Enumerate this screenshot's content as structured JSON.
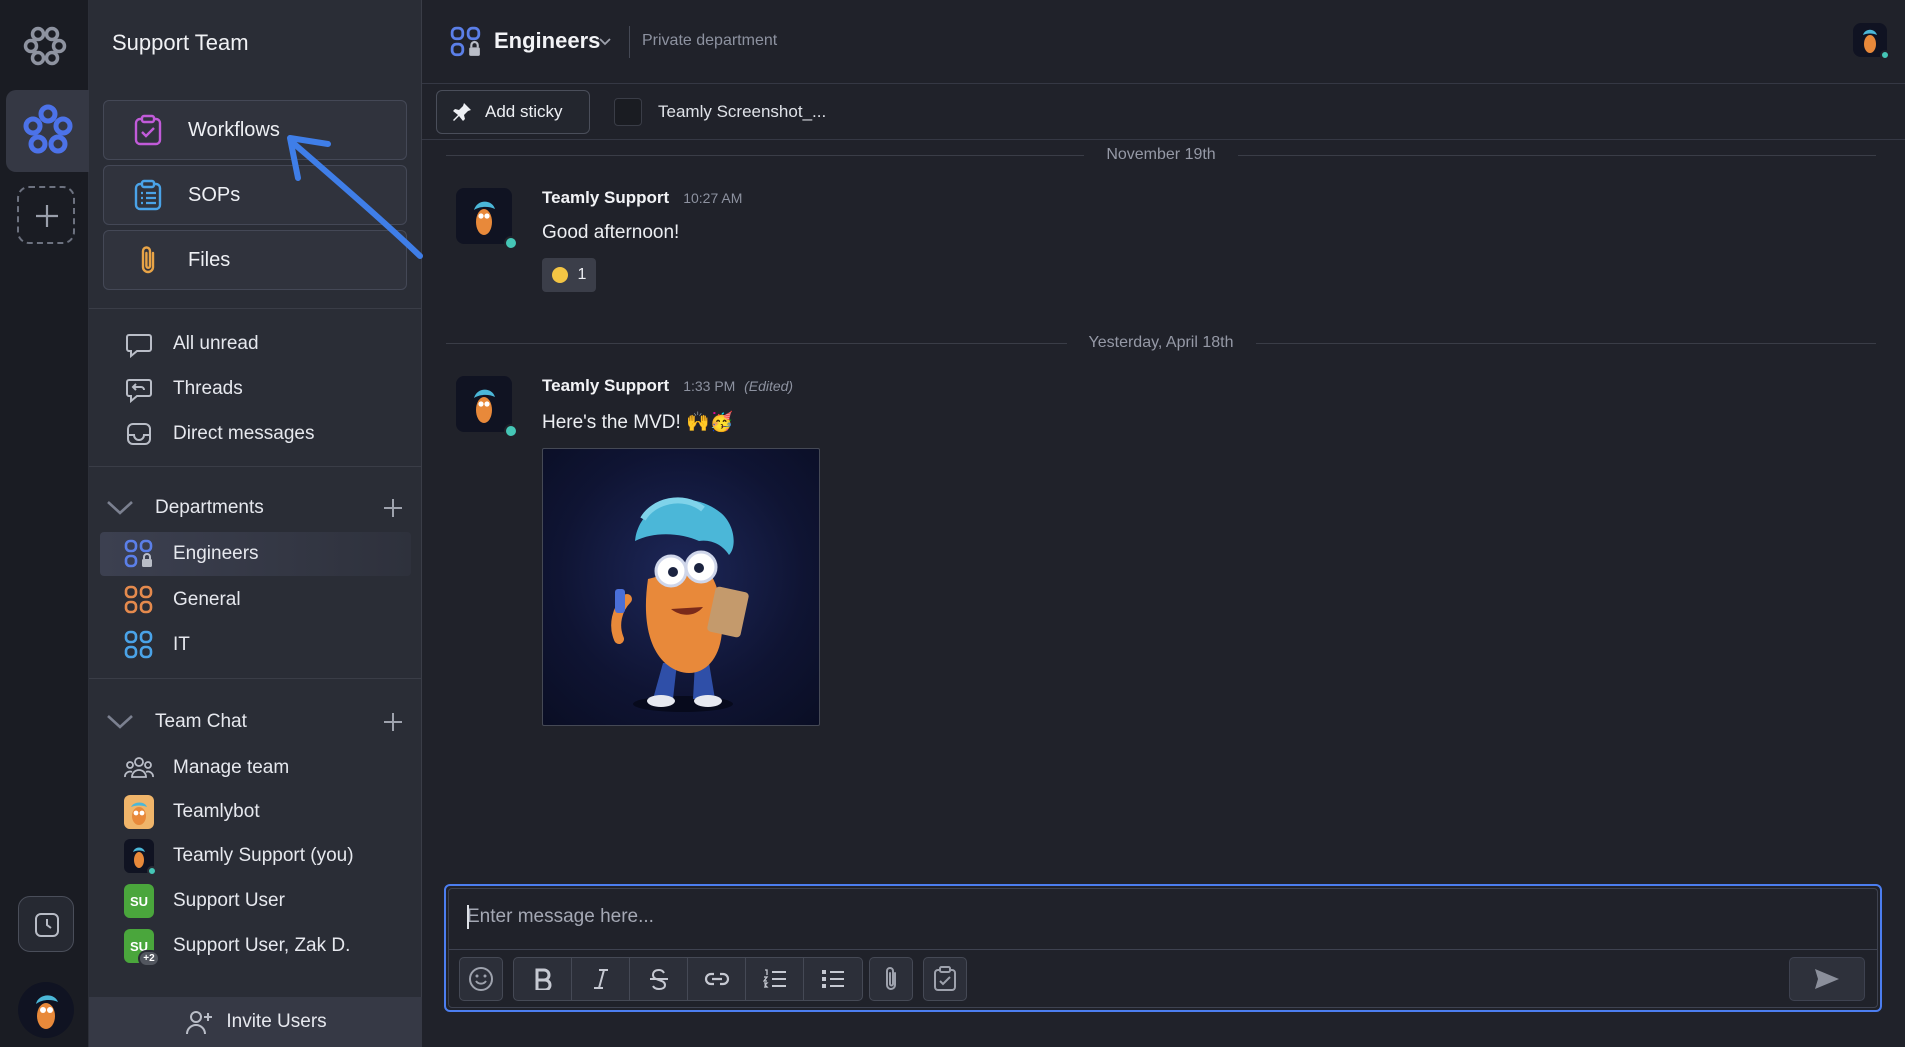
{
  "workspace": {
    "name": "Support Team"
  },
  "tools": [
    {
      "id": "workflows",
      "label": "Workflows",
      "icon": "clipboard-check-icon",
      "color": "#c15bd9"
    },
    {
      "id": "sops",
      "label": "SOPs",
      "icon": "clipboard-list-icon",
      "color": "#4aa3e8"
    },
    {
      "id": "files",
      "label": "Files",
      "icon": "paperclip-icon",
      "color": "#e8a447"
    }
  ],
  "nav": [
    {
      "id": "all-unread",
      "label": "All unread",
      "icon": "chat-bubble-icon"
    },
    {
      "id": "threads",
      "label": "Threads",
      "icon": "threads-icon"
    },
    {
      "id": "direct-messages",
      "label": "Direct messages",
      "icon": "inbox-icon"
    }
  ],
  "departments": {
    "title": "Departments",
    "items": [
      {
        "label": "Engineers",
        "color": "#5b7fe8",
        "active": true,
        "locked": true
      },
      {
        "label": "General",
        "color": "#e58a4d",
        "active": false,
        "locked": false
      },
      {
        "label": "IT",
        "color": "#4aa3e8",
        "active": false,
        "locked": false
      }
    ]
  },
  "team_chat": {
    "title": "Team Chat",
    "items": [
      {
        "label": "Manage team"
      },
      {
        "label": "Teamlybot"
      },
      {
        "label": "Teamly Support (you)"
      },
      {
        "label": "Support User",
        "initials": "SU"
      },
      {
        "label": "Support User, Zak D.",
        "initials": "SU",
        "badge": "+2"
      }
    ]
  },
  "invite_label": "Invite Users",
  "channel": {
    "name": "Engineers",
    "subtitle": "Private department"
  },
  "sticky": {
    "add_label": "Add sticky",
    "attachment": "Teamly Screenshot_..."
  },
  "day_separators": [
    "November 19th",
    "Yesterday, April 18th"
  ],
  "messages": [
    {
      "author": "Teamly Support",
      "time": "10:27 AM",
      "edited": "",
      "text": "Good afternoon!",
      "reaction_count": "1"
    },
    {
      "author": "Teamly Support",
      "time": "1:33 PM",
      "edited": "(Edited)",
      "text": "Here's the MVD! 🙌🥳"
    }
  ],
  "composer": {
    "placeholder": "Enter message here..."
  },
  "colors": {
    "accent": "#4c7ef0",
    "online": "#45c6b6",
    "sidebar": "#2a2d36",
    "main": "#20222a"
  }
}
